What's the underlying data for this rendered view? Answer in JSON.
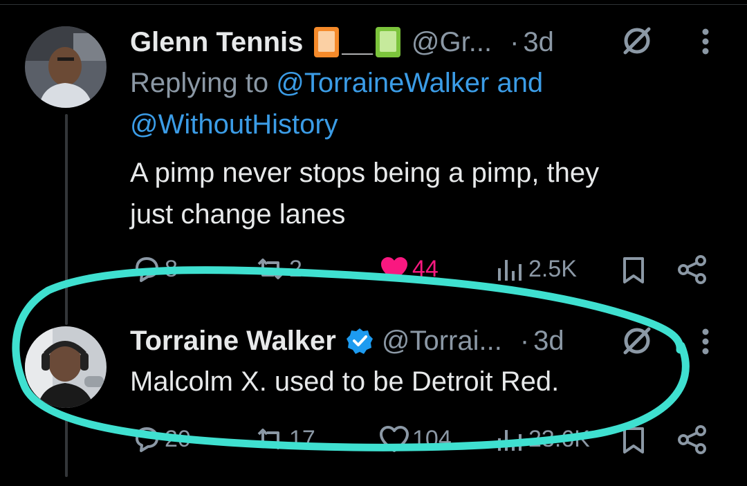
{
  "tweet1": {
    "author_name": "Glenn Tennis",
    "emoji_separator": "__",
    "handle": "@Gr...",
    "dot": "·",
    "time": "3d",
    "replying_prefix": "Replying to ",
    "replying_user1": "@TorraineWalker",
    "replying_and": " and",
    "replying_user2": "@WithoutHistory",
    "body_line1": "A pimp never stops being a pimp, they",
    "body_line2": "just change lanes",
    "replies": "8",
    "reposts": "2",
    "likes": "44",
    "views": "2.5K"
  },
  "tweet2": {
    "author_name": "Torraine Walker",
    "handle": "@Torrai...",
    "dot": "·",
    "time": "3d",
    "body": "Malcolm X. used to be Detroit Red.",
    "replies": "20",
    "reposts": "17",
    "likes": "104",
    "views": "23.6K"
  },
  "colors": {
    "like_active": "#f91880",
    "link": "#3b9ce6",
    "verified": "#1d9bf0",
    "highlight": "#3fe0d0"
  },
  "icons": [
    "grok-icon",
    "more-icon",
    "reply-icon",
    "repost-icon",
    "heart-icon",
    "views-icon",
    "bookmark-icon",
    "share-icon",
    "verified-badge-icon",
    "orange-book-emoji",
    "green-book-emoji"
  ]
}
